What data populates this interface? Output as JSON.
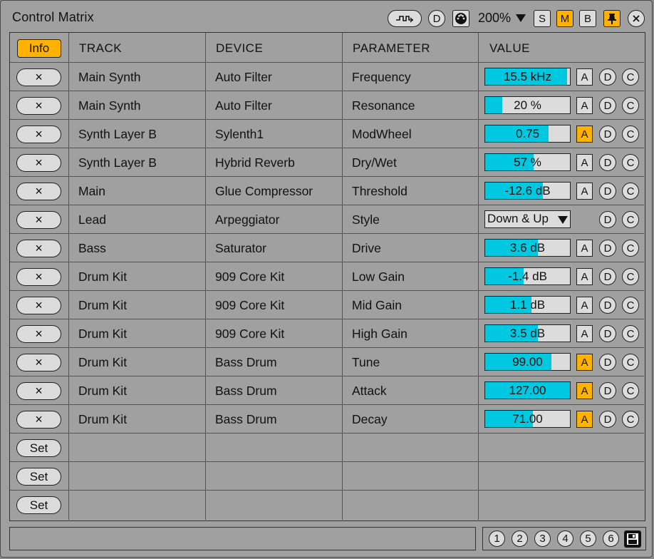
{
  "window": {
    "title": "Control Matrix"
  },
  "toolbar": {
    "d_label": "D",
    "zoom": "200%",
    "s_label": "S",
    "m_label": "M",
    "b_label": "B",
    "accent": "#ffb300"
  },
  "headers": {
    "info": "Info",
    "track": "TRACK",
    "device": "DEVICE",
    "parameter": "PARAMETER",
    "value": "VALUE"
  },
  "remove_label": "×",
  "a_label": "A",
  "d_label": "D",
  "c_label": "C",
  "set_label": "Set",
  "value_fill_color": "#00c8e0",
  "rows": [
    {
      "track": "Main Synth",
      "device": "Auto Filter",
      "parameter": "Frequency",
      "value": "15.5 kHz",
      "fill": 0.97,
      "a_on": false
    },
    {
      "track": "Main Synth",
      "device": "Auto Filter",
      "parameter": "Resonance",
      "value": "20 %",
      "fill": 0.2,
      "a_on": false
    },
    {
      "track": "Synth Layer B",
      "device": "Sylenth1",
      "parameter": "ModWheel",
      "value": "0.75",
      "fill": 0.75,
      "a_on": true
    },
    {
      "track": "Synth Layer B",
      "device": "Hybrid Reverb",
      "parameter": "Dry/Wet",
      "value": "57 %",
      "fill": 0.57,
      "a_on": false
    },
    {
      "track": "Main",
      "device": "Glue Compressor",
      "parameter": "Threshold",
      "value": "-12.6 dB",
      "fill": 0.68,
      "a_on": false
    },
    {
      "track": "Lead",
      "device": "Arpeggiator",
      "parameter": "Style",
      "value": "Down & Up",
      "dropdown": true
    },
    {
      "track": "Bass",
      "device": "Saturator",
      "parameter": "Drive",
      "value": "3.6 dB",
      "fill": 0.62,
      "a_on": false
    },
    {
      "track": "Drum Kit",
      "device": "909 Core Kit",
      "parameter": "Low Gain",
      "value": "-1.4 dB",
      "fill": 0.45,
      "a_on": false
    },
    {
      "track": "Drum Kit",
      "device": "909 Core Kit",
      "parameter": "Mid Gain",
      "value": "1.1 dB",
      "fill": 0.55,
      "a_on": false
    },
    {
      "track": "Drum Kit",
      "device": "909 Core Kit",
      "parameter": "High Gain",
      "value": "3.5 dB",
      "fill": 0.62,
      "a_on": false
    },
    {
      "track": "Drum Kit",
      "device": "Bass Drum",
      "parameter": "Tune",
      "value": "99.00",
      "fill": 0.78,
      "a_on": true
    },
    {
      "track": "Drum Kit",
      "device": "Bass Drum",
      "parameter": "Attack",
      "value": "127.00",
      "fill": 1.0,
      "a_on": true
    },
    {
      "track": "Drum Kit",
      "device": "Bass Drum",
      "parameter": "Decay",
      "value": "71.00",
      "fill": 0.56,
      "a_on": true
    }
  ],
  "empty_rows": 3,
  "slots": [
    "1",
    "2",
    "3",
    "4",
    "5",
    "6"
  ]
}
